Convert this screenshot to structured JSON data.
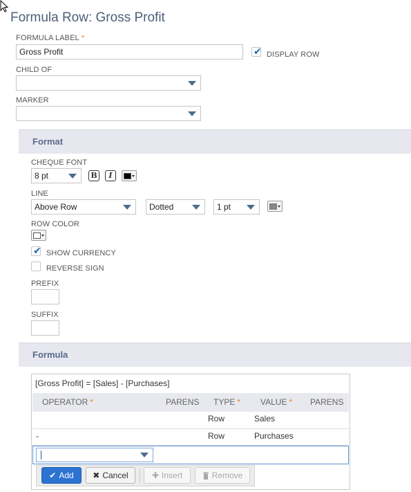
{
  "page": {
    "title": "Formula Row: Gross Profit"
  },
  "formula_label": {
    "label": "FORMULA LABEL",
    "required_mark": "*",
    "value": "Gross Profit"
  },
  "display_row": {
    "label": "DISPLAY ROW",
    "checked": true
  },
  "child_of": {
    "label": "CHILD OF",
    "value": ""
  },
  "marker": {
    "label": "MARKER",
    "value": ""
  },
  "format": {
    "section_title": "Format",
    "cheque_font": {
      "label": "CHEQUE FONT",
      "size": "8 pt",
      "bold_glyph": "B",
      "italic_glyph": "I",
      "color": "#000000"
    },
    "line": {
      "label": "LINE",
      "position": "Above Row",
      "style": "Dotted",
      "width": "1 pt",
      "color": "#888888"
    },
    "row_color": {
      "label": "ROW COLOR",
      "color": "#ffffff"
    },
    "show_currency": {
      "label": "SHOW CURRENCY",
      "checked": true
    },
    "reverse_sign": {
      "label": "REVERSE SIGN",
      "checked": false
    },
    "prefix": {
      "label": "PREFIX",
      "value": ""
    },
    "suffix": {
      "label": "SUFFIX",
      "value": ""
    }
  },
  "formula": {
    "section_title": "Formula",
    "expression": "[Gross Profit] = [Sales] - [Purchases]",
    "columns": {
      "operator": "OPERATOR",
      "parens1": "PARENS",
      "type": "TYPE",
      "value": "VALUE",
      "parens2": "PARENS",
      "required_mark": "*"
    },
    "rows": [
      {
        "operator": "",
        "parens1": "",
        "type": "Row",
        "value": "Sales",
        "parens2": ""
      },
      {
        "operator": "-",
        "parens1": "",
        "type": "Row",
        "value": "Purchases",
        "parens2": ""
      }
    ],
    "edit_row": {
      "operator_value": ""
    },
    "buttons": {
      "add": "Add",
      "cancel": "Cancel",
      "insert": "Insert",
      "remove": "Remove"
    }
  },
  "colors": {
    "accent": "#2d73d1",
    "title": "#4d5f79",
    "section_bg": "#e7e8ef",
    "required": "#e38d13",
    "check": "#2567b3"
  },
  "icons": {
    "cursor": "mouse-pointer-icon",
    "checkmark": "checkmark-icon",
    "dropdown": "chevron-down-icon",
    "add": "checkmark-icon",
    "cancel": "close-icon",
    "insert": "plus-icon",
    "remove": "trash-icon"
  }
}
